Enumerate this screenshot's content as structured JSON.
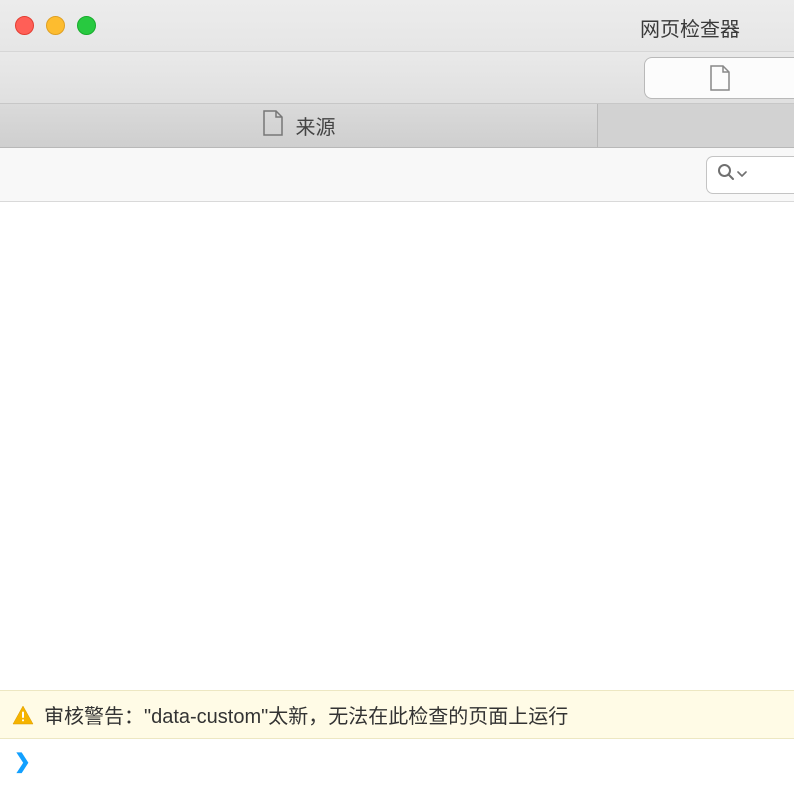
{
  "window": {
    "title": "网页检查器"
  },
  "tabs": {
    "source_label": "来源"
  },
  "console": {
    "warning_text": "审核警告：\"data-custom\"太新，无法在此检查的页面上运行",
    "prompt_symbol": "❯"
  },
  "icons": {
    "close_color": "#ff5f57",
    "min_color": "#fdbc2f",
    "max_color": "#28c940"
  }
}
